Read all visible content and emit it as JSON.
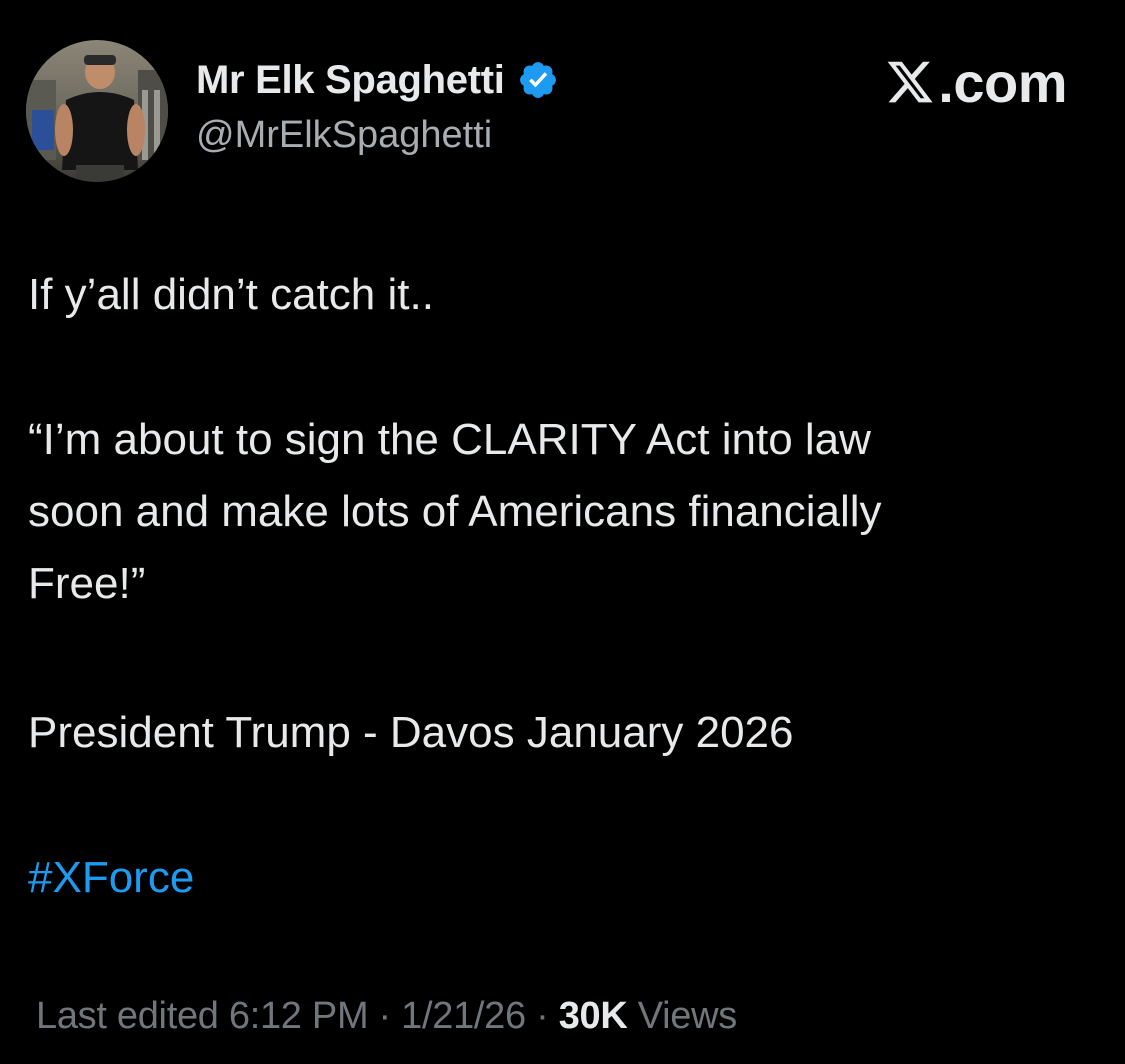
{
  "author": {
    "display_name": "Mr Elk Spaghetti",
    "handle": "@MrElkSpaghetti",
    "verified": true
  },
  "site": {
    "label": ".com",
    "logo_icon": "x-logo-icon"
  },
  "post": {
    "line1": "If y’all didn’t catch it..",
    "quote_lines": [
      "“I’m about to sign the CLARITY Act into law",
      "soon and make lots of Americans financially",
      "Free!”"
    ],
    "attribution": "President Trump - Davos January 2026",
    "hashtag": "#XForce"
  },
  "meta": {
    "edited_label": "Last edited 6:12 PM · 1/21/26 · ",
    "views_count": "30K",
    "views_label": " Views"
  },
  "colors": {
    "background": "#000000",
    "text": "#e7e9ea",
    "secondary": "#71767b",
    "link": "#1d9bf0",
    "verified_badge": "#1d9bf0"
  }
}
